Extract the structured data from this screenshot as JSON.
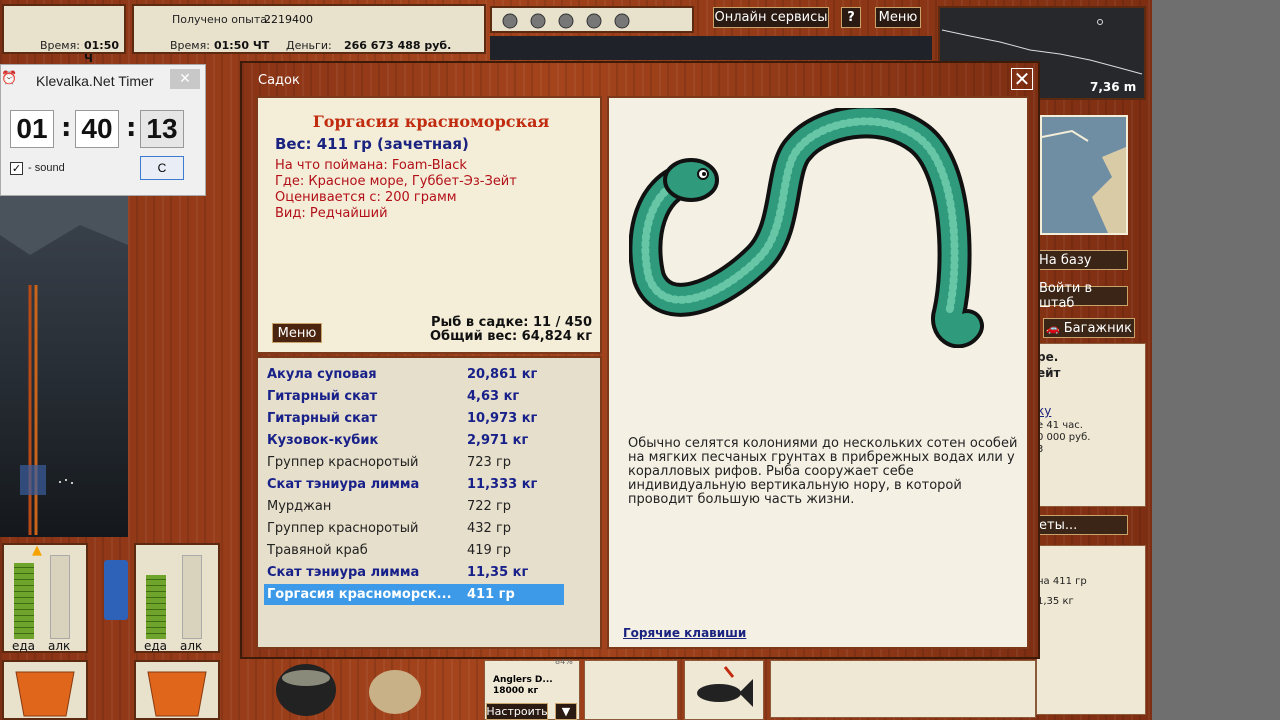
{
  "hud": {
    "exp_label": "Получено опыта:",
    "exp_value": "2219400",
    "time_label": "Время:",
    "time_value": "01:50 ЧТ",
    "time_value_short": "01:50 Ч",
    "money_label": "Деньги:",
    "money_value": "266 673 488 руб.",
    "online_button": "Онлайн сервисы",
    "help_button": "?",
    "menu_button": "Меню",
    "depth_value": "7,36 m",
    "na_bazu": "На базу",
    "v_shtab": "Войти в штаб",
    "bagazhnik": "Багажник",
    "side_text_1": "ре.",
    "side_text_2": "ейт",
    "side_link": "ку",
    "side_text_3": "е 41 час.",
    "side_text_4": "0 000 руб.",
    "side_text_5": "3",
    "side_button": "еты...",
    "side_text_6": "на 411 гр",
    "side_text_7": "1,35 кг",
    "food_label": "еда",
    "alc_label": "алк",
    "bait_name": "Anglers D...",
    "bait_percent": "84%",
    "bait_weight": "18000 кг",
    "setup_button": "Настроить",
    "setup_arrow": "▼"
  },
  "timer": {
    "title": "Klevalka.Net Timer",
    "close": "✕",
    "hours": "01",
    "minutes": "40",
    "seconds": "13",
    "sound_label": "- sound",
    "sound_checked": true,
    "reset_button": "C"
  },
  "dialog": {
    "title": "Садок",
    "close": "✕",
    "fish_name": "Горгасия красноморская",
    "fish_weight": "Вес: 411 гр (зачетная)",
    "caught_on": "На что поймана: Foam-Black",
    "location": "Где: Красное море, Губбет-Эз-Зейт",
    "valued_from": "Оценивается с: 200 грамм",
    "rarity": "Вид: Редчайший",
    "menu_button": "Меню",
    "fish_count": "Рыб в садке: 11 / 450",
    "total_weight": "Общий вес: 64,824 кг",
    "catch_list": [
      {
        "name": "Акула суповая",
        "weight": "20,861 кг",
        "style": "bold"
      },
      {
        "name": "Гитарный скат",
        "weight": "4,63 кг",
        "style": "bold"
      },
      {
        "name": "Гитарный скат",
        "weight": "10,973 кг",
        "style": "bold"
      },
      {
        "name": "Кузовок-кубик",
        "weight": "2,971 кг",
        "style": "bold"
      },
      {
        "name": "Группер красноротый",
        "weight": "723 гр",
        "style": "plain"
      },
      {
        "name": "Скат тэниура лимма",
        "weight": "11,333 кг",
        "style": "bold"
      },
      {
        "name": "Мурджан",
        "weight": "722 гр",
        "style": "plain"
      },
      {
        "name": "Группер красноротый",
        "weight": "432 гр",
        "style": "plain"
      },
      {
        "name": "Травяной краб",
        "weight": "419 гр",
        "style": "plain"
      },
      {
        "name": "Скат тэниура лимма",
        "weight": "11,35 кг",
        "style": "bold"
      },
      {
        "name": "Горгасия красноморск...",
        "weight": "411 гр",
        "style": "sel"
      }
    ],
    "description": "Обычно селятся колониями до нескольких сотен особей на мягких песчаных грунтах в прибрежных водах или у коралловых рифов. Рыба сооружает себе индивидуальную вертикальную нору, в которой проводит большую часть жизни.",
    "hotkeys_link": "Горячие клавиши"
  }
}
